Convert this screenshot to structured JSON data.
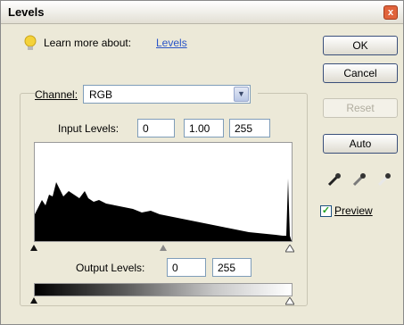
{
  "window": {
    "title": "Levels",
    "close": "x"
  },
  "learn": {
    "text": "Learn more about:",
    "link": "Levels"
  },
  "buttons": {
    "ok": "OK",
    "cancel": "Cancel",
    "reset": "Reset",
    "auto": "Auto"
  },
  "channel": {
    "label": "Channel:",
    "value": "RGB"
  },
  "input_levels": {
    "label": "Input Levels:",
    "black": "0",
    "gamma": "1.00",
    "white": "255"
  },
  "output_levels": {
    "label": "Output Levels:",
    "black": "0",
    "white": "255"
  },
  "preview": {
    "label": "Preview",
    "checked": true,
    "mark": "✓"
  },
  "eyedroppers": [
    "black-point-eyedropper-icon",
    "gray-point-eyedropper-icon",
    "white-point-eyedropper-icon"
  ],
  "colors": {
    "accent_link": "#2a55c8",
    "close": "#e0633b"
  }
}
